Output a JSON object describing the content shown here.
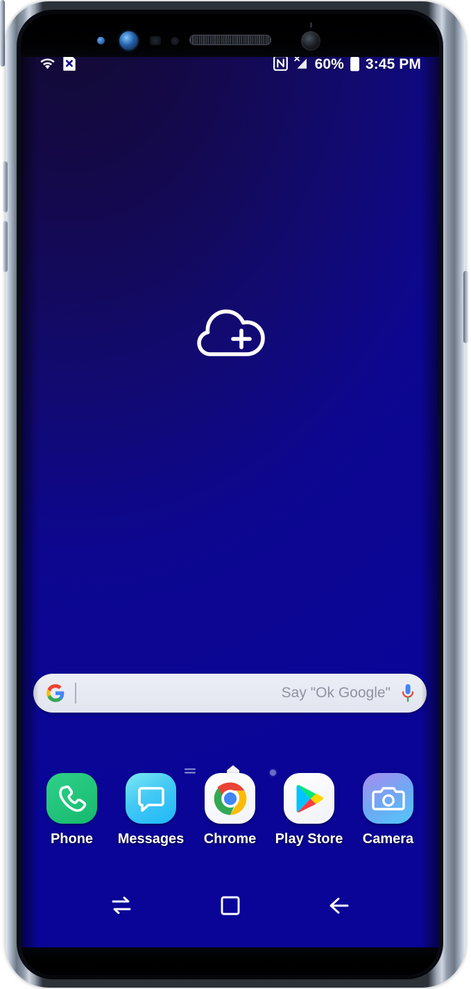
{
  "device": {
    "name": "samsung-galaxy-s9-plus",
    "frame_color": "#aeb9c9",
    "buttons": [
      {
        "name": "volume-up"
      },
      {
        "name": "volume-down"
      },
      {
        "name": "bixby"
      },
      {
        "name": "power"
      }
    ]
  },
  "status_bar": {
    "left_icons": [
      {
        "name": "wifi-icon",
        "label": "Wi-Fi connected"
      },
      {
        "name": "no-sim-icon",
        "label": "No SIM card"
      }
    ],
    "right_icons": [
      {
        "name": "nfc-icon",
        "label": "NFC"
      },
      {
        "name": "no-signal-icon",
        "label": "No mobile signal"
      },
      {
        "name": "battery-icon",
        "label": "Battery"
      }
    ],
    "battery_percent": "60%",
    "time": "3:45 PM"
  },
  "wallpaper": {
    "top_color": "#160a38",
    "bottom_color": "#0a04a0"
  },
  "widget": {
    "name": "add-cloud-widget",
    "icon": "cloud-plus-icon",
    "color": "#ffffff"
  },
  "search": {
    "logo": "google-g-logo",
    "value": "",
    "placeholder": "Say \"Ok Google\"",
    "mic_icon": "microphone-icon",
    "background": "#e8ebf3"
  },
  "page_indicators": {
    "items": [
      {
        "name": "page-indicator-feed",
        "icon": "lines-icon",
        "active": false
      },
      {
        "name": "page-indicator-home",
        "icon": "home-page-icon",
        "active": true
      },
      {
        "name": "page-indicator-dot",
        "icon": "dot-icon",
        "active": false
      }
    ]
  },
  "dock": {
    "apps": [
      {
        "label": "Phone",
        "icon": "phone-handset-icon",
        "color": "#21c47a"
      },
      {
        "label": "Messages",
        "icon": "speech-bubble-icon",
        "color": "#43c9f5"
      },
      {
        "label": "Chrome",
        "icon": "chrome-logo-icon",
        "color": "#ffffff"
      },
      {
        "label": "Play Store",
        "icon": "play-store-icon",
        "color": "#ffffff"
      },
      {
        "label": "Camera",
        "icon": "camera-icon",
        "color": "#6ea8f4"
      }
    ]
  },
  "nav_bar": {
    "buttons": [
      {
        "name": "recents-button",
        "icon": "recents-icon"
      },
      {
        "name": "home-button",
        "icon": "home-icon"
      },
      {
        "name": "back-button",
        "icon": "back-arrow-icon"
      }
    ]
  }
}
